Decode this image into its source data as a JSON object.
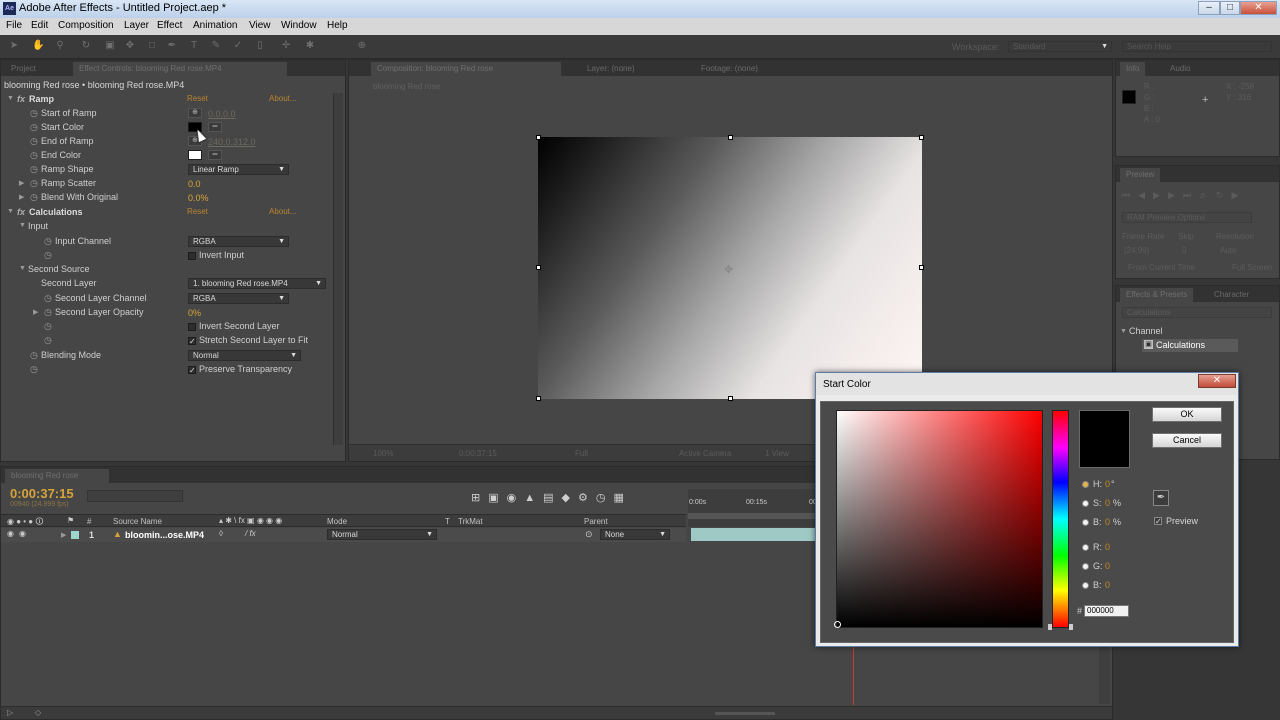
{
  "window": {
    "title": "Adobe After Effects - Untitled Project.aep *",
    "app_icon": "Ae"
  },
  "menu": [
    "File",
    "Edit",
    "Composition",
    "Layer",
    "Effect",
    "Animation",
    "View",
    "Window",
    "Help"
  ],
  "toolbar": {
    "workspace_label": "Workspace:",
    "workspace_value": "Standard",
    "search_placeholder": "Search Help"
  },
  "left_panel": {
    "tabs": [
      "Project",
      "Effect Controls: blooming Red rose.MP4"
    ],
    "header": "blooming Red rose • blooming Red rose.MP4",
    "ramp": {
      "name": "Ramp",
      "reset": "Reset",
      "about": "About...",
      "props": [
        {
          "label": "Start of Ramp",
          "value": "0.0,0.0"
        },
        {
          "label": "Start Color"
        },
        {
          "label": "End of Ramp",
          "value": "240.0,312.0"
        },
        {
          "label": "End Color"
        },
        {
          "label": "Ramp Shape",
          "value": "Linear Ramp"
        },
        {
          "label": "Ramp Scatter",
          "value": "0.0"
        },
        {
          "label": "Blend With Original",
          "value": "0.0%"
        }
      ]
    },
    "calculations": {
      "name": "Calculations",
      "reset": "Reset",
      "about": "About...",
      "input_group": "Input",
      "input_channel_label": "Input Channel",
      "input_channel_value": "RGBA",
      "invert_input": "Invert Input",
      "second_source": "Second Source",
      "second_layer_label": "Second Layer",
      "second_layer_value": "1. blooming Red rose.MP4",
      "second_layer_channel_label": "Second Layer Channel",
      "second_layer_channel_value": "RGBA",
      "second_layer_opacity_label": "Second Layer Opacity",
      "second_layer_opacity_value": "0%",
      "invert_second_layer": "Invert Second Layer",
      "stretch_second_layer": "Stretch Second Layer to Fit",
      "blending_mode_label": "Blending Mode",
      "blending_mode_value": "Normal",
      "preserve_transparency": "Preserve Transparency"
    }
  },
  "composition": {
    "tabs": [
      "Composition: blooming Red rose",
      "Layer: (none)",
      "Footage: (none)"
    ],
    "breadcrumb": "blooming Red rose",
    "footer": {
      "zoom": "100%",
      "time": "0:00:37:15",
      "resolution": "Full",
      "camera": "Active Camera",
      "view": "1 View"
    }
  },
  "right_panels": {
    "info_tabs": [
      "Info",
      "Audio"
    ],
    "info": {
      "r": "R :",
      "g": "G :",
      "b": "B :",
      "a": "A : 0",
      "x": "X : -258",
      "y": "Y : 316"
    },
    "preview_tab": "Preview",
    "preview": {
      "ram_options": "RAM Preview Options",
      "frame_rate": "Frame Rate",
      "skip": "Skip",
      "resolution": "Resolution",
      "frame_rate_val": "(24.99)",
      "skip_val": "0",
      "res_val": "Auto",
      "from_current": "From Current Time",
      "full_screen": "Full Screen"
    },
    "effects_tabs": [
      "Effects & Presets",
      "Character"
    ],
    "effects_search": "Calculations",
    "channel": "Channel",
    "calculations_item": "Calculations"
  },
  "timeline": {
    "tab": "blooming Red rose",
    "time": "0:00:37:15",
    "frames": "00940 (24.999 fps)",
    "columns": {
      "source": "Source Name",
      "mode": "Mode",
      "t": "T",
      "trkmat": "TrkMat",
      "parent": "Parent"
    },
    "ruler": [
      "0:00s",
      "00:15s",
      "00:"
    ],
    "layer": {
      "num": "1",
      "name": "bloomin...ose.MP4",
      "mode": "Normal",
      "parent": "None"
    }
  },
  "dialog": {
    "title": "Start Color",
    "ok": "OK",
    "cancel": "Cancel",
    "h_label": "H:",
    "h_val": "0",
    "h_unit": "°",
    "s_label": "S:",
    "s_val": "0",
    "s_unit": "%",
    "b_label": "B:",
    "b_val": "0",
    "b_unit": "%",
    "r_label": "R:",
    "r_val": "0",
    "g_label": "G:",
    "g_val": "0",
    "bb_label": "B:",
    "bb_val": "0",
    "hex_label": "#",
    "hex_val": "000000",
    "preview": "Preview"
  },
  "colors": {
    "accent": "#d8a43a",
    "panel": "#464646",
    "titlebar": "#c8d9ee"
  }
}
